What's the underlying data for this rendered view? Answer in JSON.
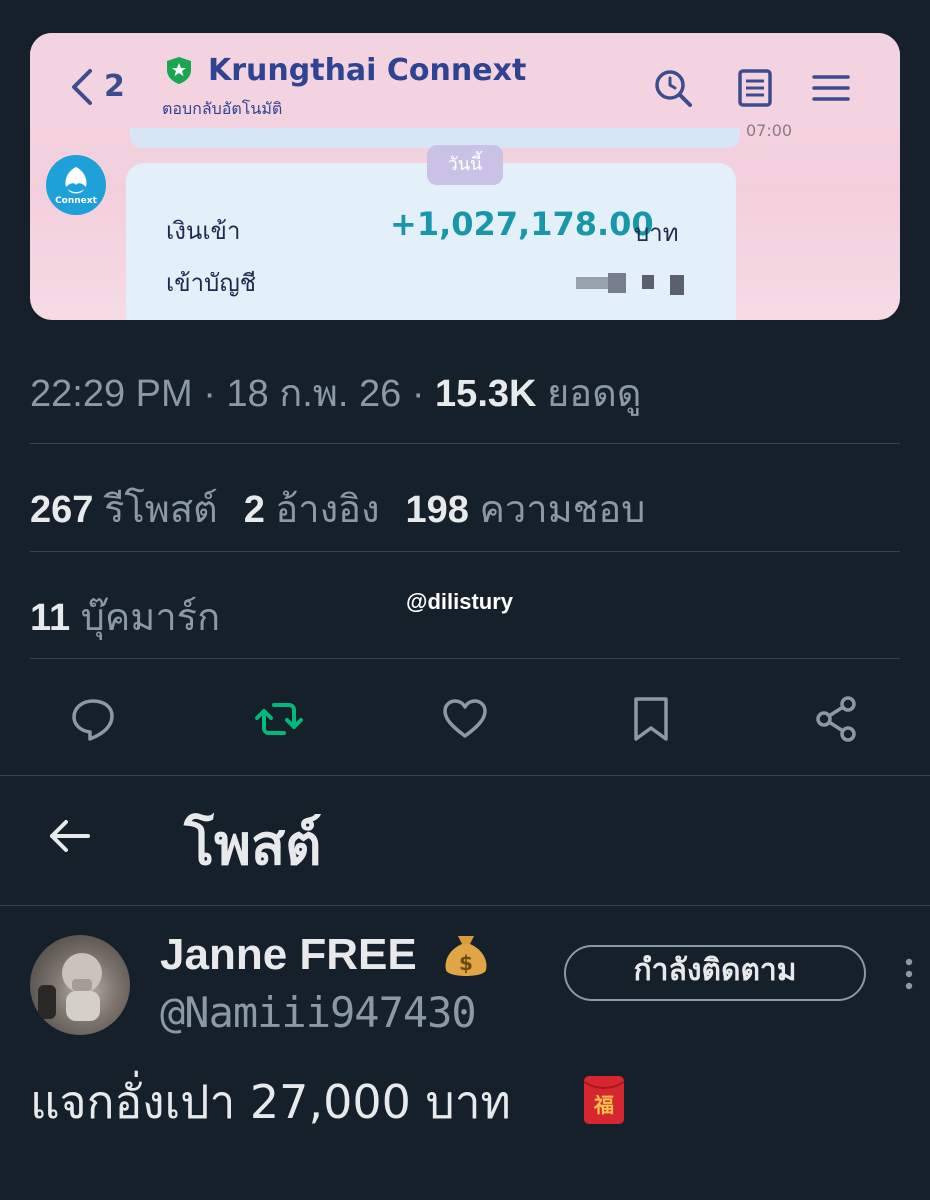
{
  "bank_card": {
    "back_count": "2",
    "app_name": "Krungthai Connext",
    "app_subtitle": "ตอบกลับอัตโนมัติ",
    "prev_time": "07:00",
    "logo_text": "Connext",
    "date_chip": "วันนี้",
    "row1_label": "เงินเข้า",
    "amount": "+1,027,178.00",
    "currency": "บาท",
    "row2_label": "เข้าบัญชี"
  },
  "tweet_meta": {
    "time": "22:29 PM",
    "date": "18 ก.พ. 26",
    "views": "15.3K",
    "views_label": "ยอดดู"
  },
  "stats": {
    "reposts": "267",
    "reposts_label": "รีโพสต์",
    "quotes": "2",
    "quotes_label": "อ้างอิง",
    "likes": "198",
    "likes_label": "ความชอบ",
    "bookmarks": "11",
    "bookmarks_label": "บุ๊คมาร์ก"
  },
  "watermark": "@dilistury",
  "actions": [
    "reply-icon",
    "retweet-icon",
    "like-icon",
    "bookmark-icon",
    "share-icon"
  ],
  "accent_retweet": "#00ba7c",
  "post_header": {
    "title": "โพสต์"
  },
  "author": {
    "display_name": "Janne FREE",
    "handle": "@Namiii947430",
    "follow_label": "กำลังติดตาม"
  },
  "tweet": {
    "text": "แจกอั่งเปา 27,000 บาท"
  }
}
